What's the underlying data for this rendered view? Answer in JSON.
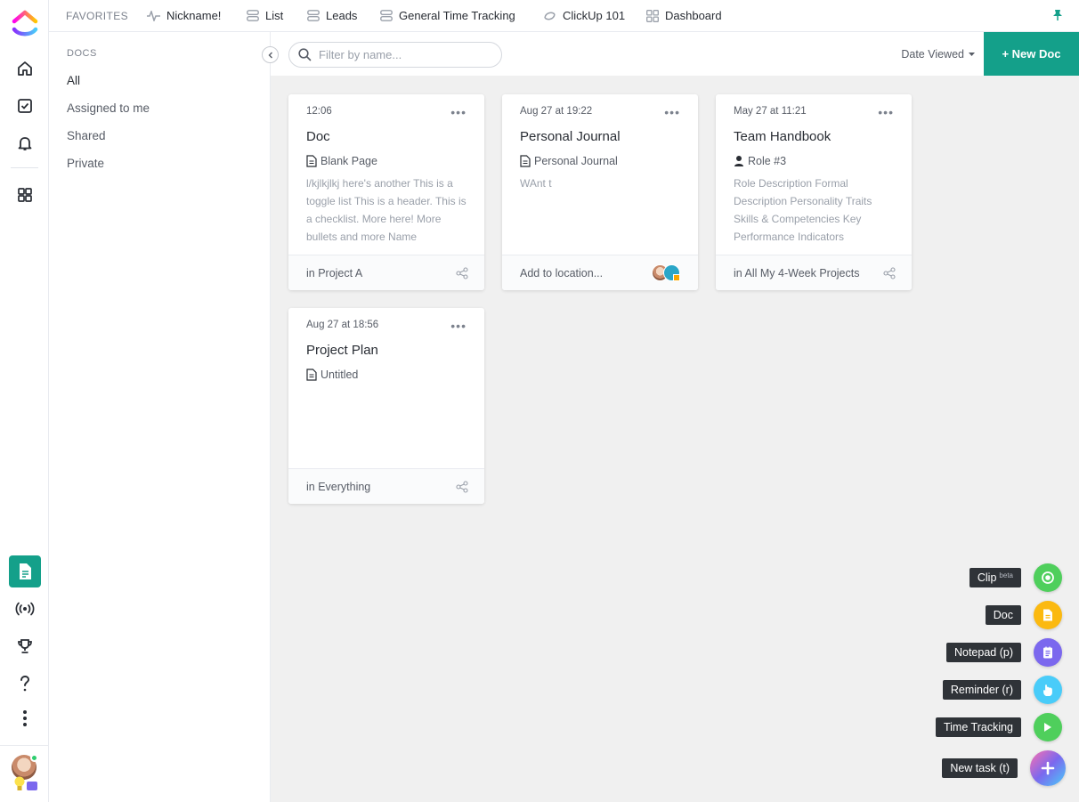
{
  "favorites": {
    "label": "FAVORITES",
    "items": [
      {
        "label": "Nickname!",
        "icon": "pulse-icon"
      },
      {
        "label": "List",
        "icon": "list-icon"
      },
      {
        "label": "Leads",
        "icon": "list-icon"
      },
      {
        "label": "General Time Tracking",
        "icon": "list-icon"
      },
      {
        "label": "ClickUp 101",
        "icon": "space-icon"
      },
      {
        "label": "Dashboard",
        "icon": "dashboard-icon"
      }
    ]
  },
  "sidebar": {
    "section_title": "DOCS",
    "items": [
      {
        "label": "All",
        "active": true
      },
      {
        "label": "Assigned to me"
      },
      {
        "label": "Shared"
      },
      {
        "label": "Private"
      }
    ]
  },
  "toolbar": {
    "search_placeholder": "Filter by name...",
    "sort_label": "Date Viewed",
    "new_doc_label": "+ New Doc"
  },
  "cards": [
    {
      "date": "12:06",
      "title": "Doc",
      "subtitle": "Blank Page",
      "subtitle_icon": "page-icon",
      "preview": "l/kjlkjlkj here's another This is a toggle list This is a header. This is a checklist. More here! More bullets and more Name",
      "location": "in Project A",
      "footer_icon": "share-icon"
    },
    {
      "date": "Aug 27 at 19:22",
      "title": "Personal Journal",
      "subtitle": "Personal Journal",
      "subtitle_icon": "page-icon",
      "preview": "WAnt t",
      "location": "Add to location...",
      "footer_icon": "people-avatars"
    },
    {
      "date": "May 27 at 11:21",
      "title": "Team Handbook",
      "subtitle": "Role #3",
      "subtitle_icon": "person-icon",
      "preview": "Role Description Formal Description Personality Traits Skills & Competencies Key Performance Indicators",
      "location": "in All My 4-Week Projects",
      "footer_icon": "share-icon"
    },
    {
      "date": "Aug 27 at 18:56",
      "title": "Project Plan",
      "subtitle": "Untitled",
      "subtitle_icon": "page-icon",
      "preview": "",
      "location": "in Everything",
      "footer_icon": "share-icon"
    }
  ],
  "quick_actions": [
    {
      "label": "Clip",
      "badge": "beta",
      "color": "#4fcf5c",
      "icon": "record-icon"
    },
    {
      "label": "Doc",
      "color": "#fbb910",
      "icon": "doc-icon"
    },
    {
      "label": "Notepad (p)",
      "color": "#7b68ee",
      "icon": "notepad-icon"
    },
    {
      "label": "Reminder (r)",
      "color": "#49ccf9",
      "icon": "reminder-icon"
    },
    {
      "label": "Time Tracking",
      "color": "#4fcf5c",
      "icon": "play-icon"
    },
    {
      "label": "New task (t)",
      "color": "#7b68ee",
      "icon": "plus-icon"
    }
  ],
  "colors": {
    "accent": "#14a08a",
    "background": "#f0f0f0"
  }
}
